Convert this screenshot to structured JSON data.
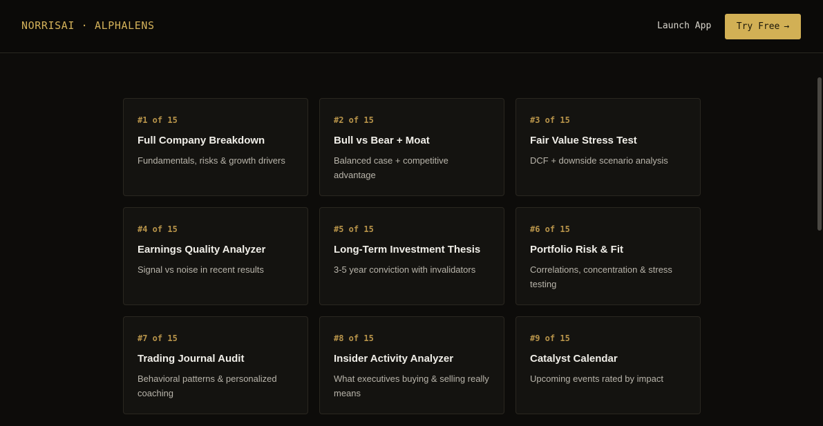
{
  "header": {
    "brand": "NORRISAI · ALPHALENS",
    "launch_label": "Launch App",
    "try_label": "Try Free",
    "try_arrow": "→"
  },
  "cards": [
    {
      "rank": "#1 of 15",
      "title": "Full Company Breakdown",
      "desc": "Fundamentals, risks & growth drivers"
    },
    {
      "rank": "#2 of 15",
      "title": "Bull vs Bear + Moat",
      "desc": "Balanced case + competitive advantage"
    },
    {
      "rank": "#3 of 15",
      "title": "Fair Value Stress Test",
      "desc": "DCF + downside scenario analysis"
    },
    {
      "rank": "#4 of 15",
      "title": "Earnings Quality Analyzer",
      "desc": "Signal vs noise in recent results"
    },
    {
      "rank": "#5 of 15",
      "title": "Long-Term Investment Thesis",
      "desc": "3-5 year conviction with invalidators"
    },
    {
      "rank": "#6 of 15",
      "title": "Portfolio Risk & Fit",
      "desc": "Correlations, concentration & stress testing"
    },
    {
      "rank": "#7 of 15",
      "title": "Trading Journal Audit",
      "desc": "Behavioral patterns & personalized coaching"
    },
    {
      "rank": "#8 of 15",
      "title": "Insider Activity Analyzer",
      "desc": "What executives buying & selling really means"
    },
    {
      "rank": "#9 of 15",
      "title": "Catalyst Calendar",
      "desc": "Upcoming events rated by impact"
    }
  ],
  "colors": {
    "accent": "#d2b055",
    "rank": "#b8944a",
    "background": "#0d0c0a",
    "card": "#141310"
  }
}
